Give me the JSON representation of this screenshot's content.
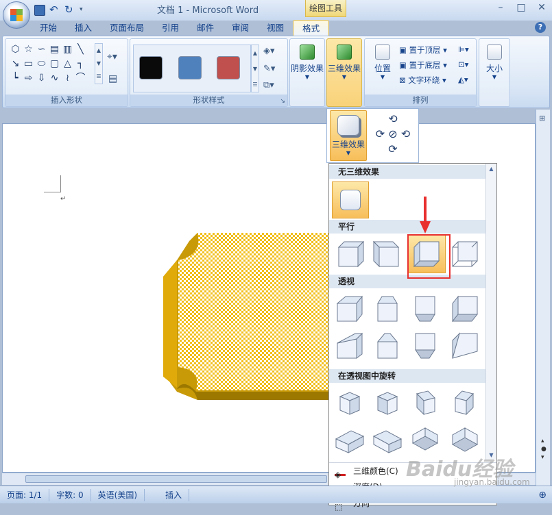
{
  "window": {
    "title": "文档 1 - Microsoft Word",
    "contextual_tab_group": "绘图工具",
    "controls": [
      "–",
      "□",
      "✕"
    ]
  },
  "tabs": [
    "开始",
    "插入",
    "页面布局",
    "引用",
    "邮件",
    "审阅",
    "视图",
    "格式"
  ],
  "ribbon": {
    "insert_shapes_label": "插入形状",
    "shape_styles_label": "形状样式",
    "arrange_label": "排列",
    "shadow_effects": "阴影效果",
    "effects_3d": "三维效果",
    "position": "位置",
    "bring_to_front": "置于顶层",
    "send_to_back": "置于底层",
    "text_wrap": "文字环绕",
    "size": "大小",
    "style_colors": [
      "#0a0a0a",
      "#4f81bd",
      "#c0504d"
    ]
  },
  "popup": {
    "button_label": "三维效果",
    "sections": {
      "none": "无三维效果",
      "parallel": "平行",
      "perspective": "透视",
      "rotate_perspective": "在透视图中旋转"
    },
    "menu": {
      "color_3d": "三维颜色(C)",
      "depth": "深度(D)",
      "direction": "方向"
    }
  },
  "status": {
    "page": "页面: 1/1",
    "words": "字数: 0",
    "language": "英语(美国)",
    "mode": "插入"
  },
  "watermark": {
    "main": "Baidu经验",
    "sub": "jingyan.baidu.com"
  }
}
